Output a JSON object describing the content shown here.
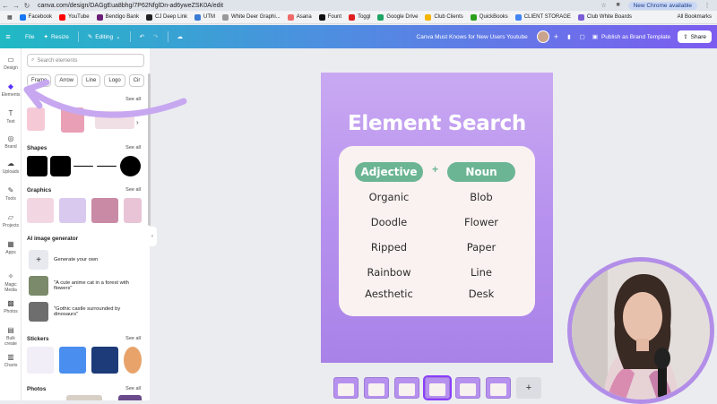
{
  "browser": {
    "url": "canva.com/design/DAGgEua8bhg/7P62NfglDn-ad6yweZSK0A/edit",
    "update_label": "New Chrome available",
    "bookmarks": [
      "Facebook",
      "YouTube",
      "Bendigo Bank",
      "CJ Deep Link",
      "UTM",
      "White Deer Graphi...",
      "Asana",
      "Fount",
      "Toggl",
      "Google Drive",
      "Club Clients",
      "QuickBooks",
      "CLIENT STORAGE",
      "Club White Boards"
    ],
    "all_bookmarks": "All Bookmarks"
  },
  "appbar": {
    "file": "File",
    "resize": "Resize",
    "editing": "Editing",
    "doc_title": "Canva Must Knows for New Users Youtube",
    "publish": "Publish as Brand Template",
    "share": "Share"
  },
  "rail": [
    "Design",
    "Elements",
    "Text",
    "Brand",
    "Uploads",
    "Tools",
    "Projects",
    "Apps",
    "Magic Media",
    "Photos",
    "Bulk create",
    "Charts"
  ],
  "panel": {
    "search_placeholder": "Search elements",
    "chips": [
      "Frame",
      "Arrow",
      "Line",
      "Logo",
      "Cir"
    ],
    "see_all": "See all",
    "shapes": "Shapes",
    "graphics": "Graphics",
    "ai_title": "AI image generator",
    "generate": "Generate your own",
    "prompt1": "\"A cute anime cat in a forest with flowers\"",
    "prompt2": "\"Gothic castle surrounded by dinosaurs\"",
    "stickers": "Stickers",
    "photos": "Photos"
  },
  "design": {
    "heading": "Element Search",
    "left_tag": "Adjective",
    "right_tag": "Noun",
    "plus": "+",
    "adjectives": [
      "Organic",
      "Doodle",
      "Ripped",
      "Rainbow",
      "Aesthetic"
    ],
    "nouns": [
      "Blob",
      "Flower",
      "Paper",
      "Line",
      "Desk"
    ]
  },
  "colors": {
    "accent": "#8b3dff",
    "design_bg": "#b791ee",
    "tag_green": "#6cb594",
    "card_bg": "#faf2f0"
  }
}
